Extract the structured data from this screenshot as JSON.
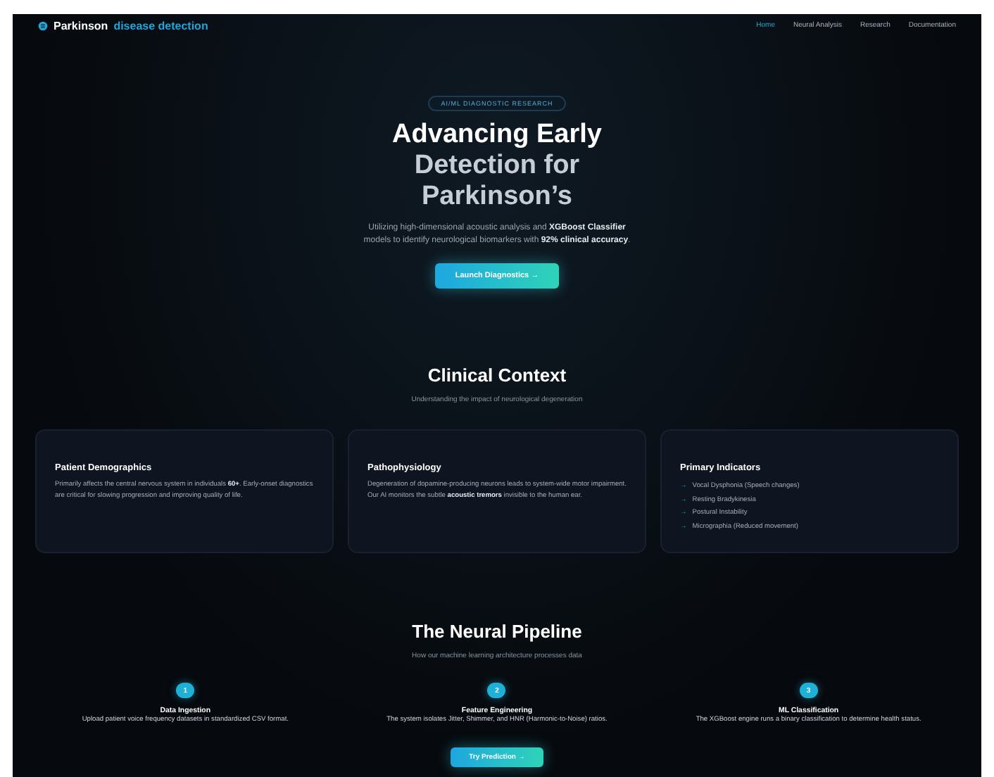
{
  "nav": {
    "brand": "Parkinson",
    "brand_accent": "disease detection",
    "links": [
      {
        "label": "Home",
        "selected": true
      },
      {
        "label": "Neural Analysis",
        "selected": false
      },
      {
        "label": "Research",
        "selected": false
      },
      {
        "label": "Documentation",
        "selected": false
      }
    ]
  },
  "hero": {
    "badge": "AI/ML DIAGNOSTIC RESEARCH",
    "title_lines": [
      "Advancing Early",
      "Detection for",
      "Parkinson’s"
    ],
    "text": "Utilizing high-dimensional acoustic analysis and **XGBoost Classifier** models to identify neurological biomarkers with **92% clinical accuracy**.",
    "button": "Launch Diagnostics  →"
  },
  "context": {
    "title": "Clinical Context",
    "subtitle": "Understanding the impact of neurological degeneration",
    "cards": [
      {
        "kind": "text",
        "title": "Patient Demographics",
        "text": "Primarily affects the central nervous system in individuals **60+**. Early-onset diagnostics are critical for slowing progression and improving quality of life."
      },
      {
        "kind": "text",
        "title": "Pathophysiology",
        "text": "Degeneration of dopamine-producing neurons leads to system-wide motor impairment. Our AI monitors the subtle **acoustic tremors** invisible to the human ear."
      },
      {
        "kind": "list",
        "title": "Primary Indicators",
        "items": [
          {
            "marker": "→",
            "text": "Vocal Dysphonia (Speech changes)"
          },
          {
            "marker": "→",
            "text": "Resting Bradykinesia"
          },
          {
            "marker": "→",
            "text": "Postural Instability"
          },
          {
            "marker": "→",
            "text": "Micrographia (Reduced movement)"
          }
        ]
      }
    ]
  },
  "pipeline": {
    "title": "The Neural Pipeline",
    "subtitle": "How our machine learning architecture processes data",
    "steps": [
      {
        "number": "1",
        "title": "Data Ingestion",
        "text": "Upload patient voice frequency datasets in standardized CSV format."
      },
      {
        "number": "2",
        "title": "Feature Engineering",
        "text": "The system isolates Jitter, Shimmer, and HNR (Harmonic-to-Noise) ratios."
      },
      {
        "number": "3",
        "title": "ML Classification",
        "text": "The XGBoost engine runs a binary classification to determine health status."
      }
    ],
    "button": "Try Prediction →"
  }
}
